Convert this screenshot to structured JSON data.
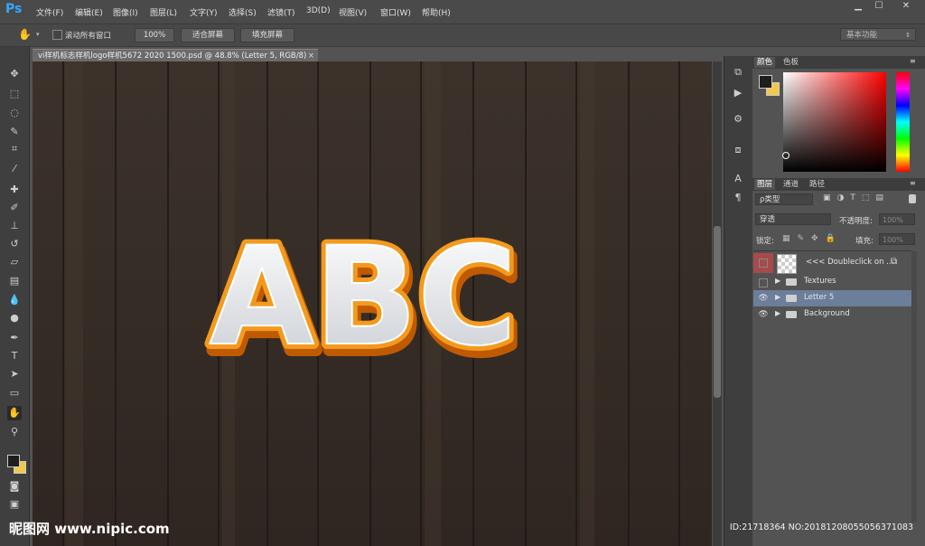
{
  "app": {
    "logo_text": "Ps"
  },
  "menu": {
    "items": [
      "文件(F)",
      "编辑(E)",
      "图像(I)",
      "图层(L)",
      "文字(Y)",
      "选择(S)",
      "滤镜(T)",
      "3D(D)",
      "视图(V)",
      "窗口(W)",
      "帮助(H)"
    ]
  },
  "window_controls": {
    "minimize": "▁",
    "restore": "☐",
    "close": "✕"
  },
  "options_bar": {
    "scroll_all_label": "滚动所有窗口",
    "zoom_100": "100%",
    "fit_screen": "适合屏幕",
    "fill_screen": "填充屏幕",
    "workspace": "基本功能"
  },
  "document": {
    "tab_title": "vi样机标志样机logo样机5672 2020 1500.psd @ 48.8% (Letter 5, RGB/8)",
    "artwork_text": "ABC"
  },
  "color_panel": {
    "tabs": [
      "颜色",
      "色板"
    ],
    "foreground": "#1e1e1e",
    "background": "#f2c84b",
    "picker_hue": "#ff0000"
  },
  "layers_panel": {
    "tabs": [
      "图层",
      "通道",
      "路径"
    ],
    "filter_kind": "ρ类型",
    "blend_mode": "穿透",
    "opacity_label": "不透明度:",
    "opacity_value": "100%",
    "lock_label": "锁定:",
    "fill_label": "填充:",
    "fill_value": "100%",
    "layers": [
      {
        "name": "<<< Doubleclick on ...",
        "visible": false,
        "type": "smart"
      },
      {
        "name": "Textures",
        "visible": false,
        "type": "group"
      },
      {
        "name": "Letter 5",
        "visible": true,
        "type": "group",
        "selected": true
      },
      {
        "name": "Background",
        "visible": true,
        "type": "group"
      }
    ]
  },
  "watermark": {
    "left": "昵图网 www.nipic.com",
    "right": "ID:21718364 NO:20181208055056371083"
  },
  "colors": {
    "accent_selected_layer": "#6b7e9a",
    "artwork_orange": "#e8820c"
  }
}
